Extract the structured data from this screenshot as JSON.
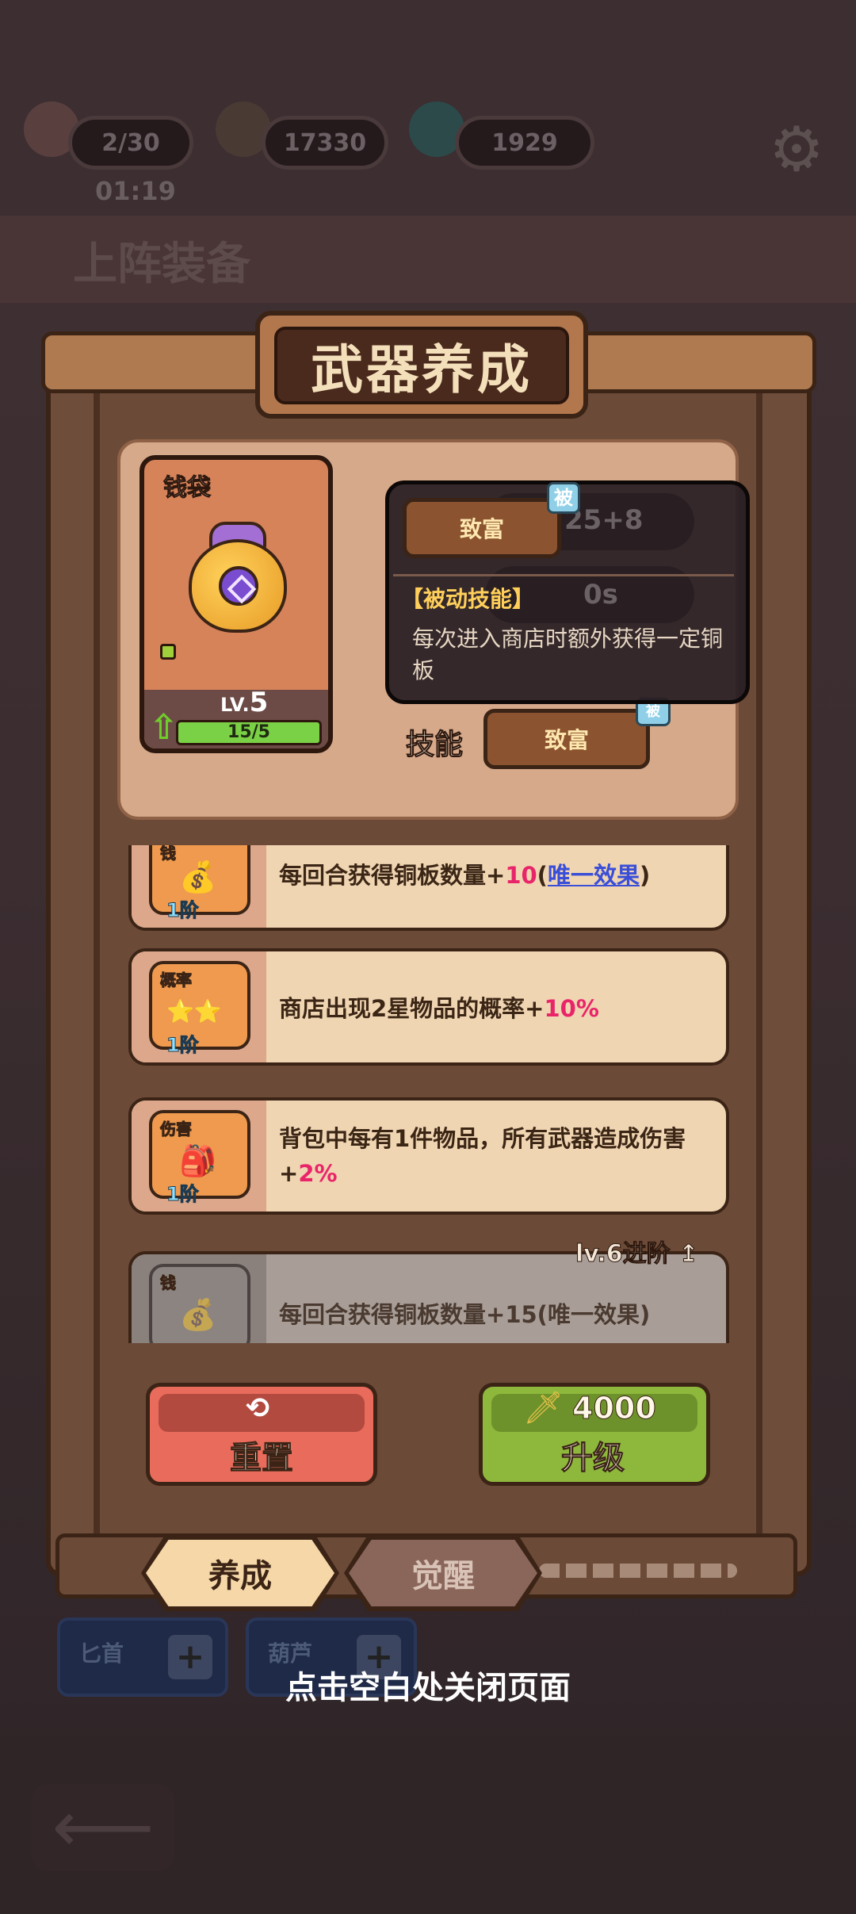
{
  "background": {
    "resources": [
      {
        "name": "stamina",
        "value": "2/30",
        "icon": "peach-icon"
      },
      {
        "name": "coins",
        "value": "17330",
        "icon": "sword-icon"
      },
      {
        "name": "gems",
        "value": "1929",
        "icon": "orb-icon"
      }
    ],
    "timer": "01:19",
    "section_title": "上阵装备",
    "slots": [
      {
        "label": "匕首"
      },
      {
        "label": "葫芦"
      }
    ],
    "settings_icon": "gear-icon",
    "back_icon": "back-arrow-icon"
  },
  "modal": {
    "title": "武器养成",
    "weapon": {
      "name": "钱袋",
      "level_prefix": "LV.",
      "level": "5",
      "progress_text": "15/5",
      "progress_fraction": 1.0,
      "icon": "money-bag-icon"
    },
    "tooltip": {
      "skill_name": "致富",
      "badge": "被",
      "faded_value": "25+8",
      "faded_value2": "0s",
      "heading": "【被动技能】",
      "description": "每次进入商店时额外获得一定铜板"
    },
    "skill": {
      "label": "技能",
      "button": "致富",
      "badge": "被"
    },
    "effects": [
      {
        "tag": "钱",
        "tier": "1阶",
        "text_prefix": "每回合获得铜板数量+",
        "value": "10",
        "text_mid": "(",
        "link": "唯一效果",
        "text_suffix": ")",
        "glyph": "💰",
        "locked": false
      },
      {
        "tag": "概率",
        "tier": "1阶",
        "text_prefix": "商店出现2星物品的概率+",
        "value": "10%",
        "glyph": "⭐⭐",
        "locked": false
      },
      {
        "tag": "伤害",
        "tier": "1阶",
        "text_prefix": "背包中每有1件物品，所有武器造成伤害+",
        "value": "2%",
        "glyph": "🎒",
        "locked": false
      },
      {
        "tag": "钱",
        "tier": "",
        "text_prefix": "每回合获得铜板数量+",
        "value": "15",
        "text_mid": "(",
        "link": "唯一效果",
        "text_suffix": ")",
        "glyph": "💰",
        "locked": true
      }
    ],
    "lock_note": "lv.6进阶",
    "buttons": {
      "reset_label": "重置",
      "upgrade_label": "升级",
      "upgrade_cost": "4000"
    },
    "tabs": [
      {
        "label": "养成",
        "active": true
      },
      {
        "label": "觉醒",
        "active": false
      }
    ]
  },
  "close_hint": "点击空白处关闭页面",
  "colors": {
    "highlight_number": "#e9256a",
    "link": "#3a4ed8",
    "upgrade_green": "#8eb83c",
    "reset_red": "#e96b5b"
  }
}
